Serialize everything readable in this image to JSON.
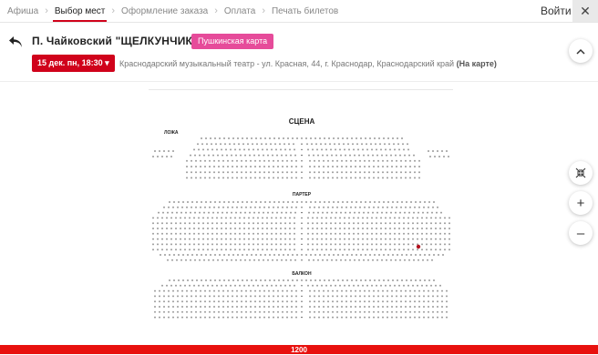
{
  "breadcrumbs": [
    {
      "label": "Афиша"
    },
    {
      "label": "Выбор мест"
    },
    {
      "label": "Оформление заказа"
    },
    {
      "label": "Оплата"
    },
    {
      "label": "Печать билетов"
    }
  ],
  "login_label": "Войти",
  "close_symbol": "✕",
  "event": {
    "title": "П. Чайковский \"ЩЕЛКУНЧИК\"",
    "pushkin_label": "Пушкинская карта",
    "date_label": "15 дек. пн, 18:30 ▾",
    "venue": "Краснодарский музыкальный театр - ул. Красная, 44, г. Краснодар, Краснодарский край",
    "map_link": "(На карте)"
  },
  "hall": {
    "stage_label": "СЦЕНА",
    "box_label": "ЛОЖА",
    "parterre_label": "ПАРТЕР",
    "balcony_label": "БАЛКОН",
    "selected_color": "#b3121f",
    "seat_color": "#9a9a9a"
  },
  "tools": {
    "fit_icon": "collapse-arrows-icon",
    "zoom_in": "+",
    "zoom_out": "–"
  },
  "footer": {
    "price": "1200",
    "color": "#e8110e"
  },
  "colors": {
    "accent": "#d0021b",
    "pushkin": "#e64b9a"
  }
}
